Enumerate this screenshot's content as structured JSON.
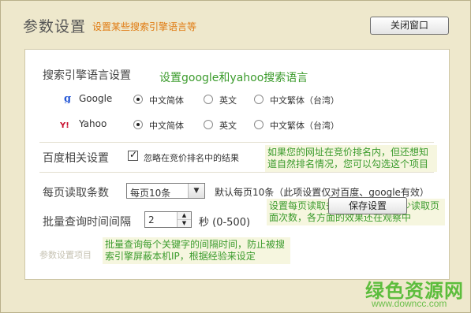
{
  "header": {
    "title": "参数设置",
    "subtitle": "设置某些搜索引擎语言等",
    "close_label": "关闭窗口"
  },
  "language": {
    "label": "搜索引擎语言设置",
    "note": "设置google和yahoo搜索语言",
    "engines": [
      {
        "name": "Google",
        "icon": "google-g-icon",
        "options": [
          "中文简体",
          "英文",
          "中文繁体（台湾）"
        ],
        "selected": "中文简体"
      },
      {
        "name": "Yahoo",
        "icon": "yahoo-icon",
        "options": [
          "中文简体",
          "英文",
          "中文繁体（台湾）"
        ],
        "selected": "中文简体"
      }
    ]
  },
  "baidu": {
    "label": "百度相关设置",
    "checkbox_label": "忽略在竞价排名中的结果",
    "checked": true,
    "callout": "如果您的网址在竞价排名内，但还想知道自然排名情况，您可以勾选这个项目"
  },
  "per_page": {
    "label": "每页读取条数",
    "selected": "每页10条",
    "default_note": "默认每页10条（此项设置仅对百度、google有效）",
    "callout": "设置每页读取条数，可以大大减少读取页面次数，各方面的效果还在观察中"
  },
  "interval": {
    "label": "批量查询时间间隔",
    "value": "2",
    "unit": "秒 (0-500)",
    "callout": "批量查询每个关键字的间隔时间，防止被搜索引擎屏蔽本机IP，根据经验来设定"
  },
  "footer": {
    "faded_text": "参数设置项目",
    "save_label": "保存设置"
  },
  "watermark": {
    "main": "绿色资源网",
    "url": "www.downcc.com"
  },
  "colors": {
    "background": "#efe9cf",
    "accent_orange": "#e07a10",
    "note_green": "#3b9b2c"
  }
}
